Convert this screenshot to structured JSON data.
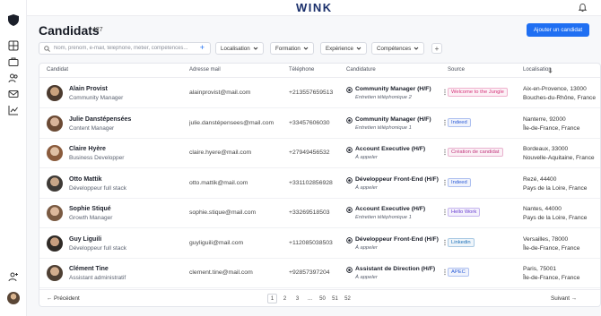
{
  "topbar": {
    "brand": "WINK"
  },
  "sidebar": {
    "items": [
      {
        "name": "layout-grid-icon"
      },
      {
        "name": "briefcase-icon"
      },
      {
        "name": "users-icon"
      },
      {
        "name": "mail-icon"
      },
      {
        "name": "chart-icon"
      }
    ]
  },
  "header": {
    "title": "Candidats",
    "count": "427",
    "add_button": "Ajouter un candidat"
  },
  "search": {
    "placeholder": "Nom, prénom, e-mail, téléphone, métier, compétences..."
  },
  "filters": [
    "Localisation",
    "Formation",
    "Expérience",
    "Compétences"
  ],
  "table": {
    "columns": [
      "Candidat",
      "Adresse mail",
      "Téléphone",
      "Candidature",
      "Source",
      "Localisation"
    ],
    "rows": [
      {
        "name": "Alain Provist",
        "role": "Community Manager",
        "email": "alainprovist@mail.com",
        "phone": "+213557659513",
        "job": "Community Manager (H/F)",
        "step": "Entretien téléphonique 2",
        "source": "Welcome to the Jungle",
        "loc1": "Aix-en-Provence, 13000",
        "loc2": "Bouches-du-Rhône, France"
      },
      {
        "name": "Julie Danstépensées",
        "role": "Content Manager",
        "email": "julie.danstépensees@mail.com",
        "phone": "+33457606030",
        "job": "Community Manager (H/F)",
        "step": "Entretien téléphonique 1",
        "source": "Indeed",
        "loc1": "Nanterre, 92000",
        "loc2": "Île-de-France, France"
      },
      {
        "name": "Claire Hyère",
        "role": "Business Developper",
        "email": "claire.hyere@mail.com",
        "phone": "+27949456532",
        "job": "Account Executive (H/F)",
        "step": "À appeler",
        "source": "Création de candidat",
        "loc1": "Bordeaux, 33000",
        "loc2": "Nouvelle-Aquitaine, France"
      },
      {
        "name": "Otto Mattik",
        "role": "Développeur full stack",
        "email": "otto.mattik@mail.com",
        "phone": "+331102856928",
        "job": "Développeur Front-End (H/F)",
        "step": "À appeler",
        "source": "Indeed",
        "loc1": "Rezé, 44400",
        "loc2": "Pays de la Loire, France"
      },
      {
        "name": "Sophie Stiqué",
        "role": "Growth Manager",
        "email": "sophie.stique@mail.com",
        "phone": "+33269518503",
        "job": "Account Executive (H/F)",
        "step": "Entretien téléphonique 1",
        "source": "Hello Work",
        "loc1": "Nantes, 44000",
        "loc2": "Pays de la Loire, France"
      },
      {
        "name": "Guy Liguili",
        "role": "Développeur full stack",
        "email": "guyliguili@mail.com",
        "phone": "+112085038503",
        "job": "Développeur Front-End (H/F)",
        "step": "À appeler",
        "source": "Linkedin",
        "loc1": "Versailles, 78000",
        "loc2": "Île-de-France, France"
      },
      {
        "name": "Clément Tine",
        "role": "Assistant administratif",
        "email": "clement.tine@mail.com",
        "phone": "+92857397204",
        "job": "Assistant de Direction (H/F)",
        "step": "À appeler",
        "source": "APEC",
        "loc1": "Paris, 75001",
        "loc2": "Île-de-France, France"
      }
    ]
  },
  "source_colors": {
    "Welcome to the Jungle": "#d6337a",
    "Indeed": "#2a5bd7",
    "Création de candidat": "#c2367d",
    "Hello Work": "#6a3fd1",
    "Linkedin": "#1a6fb8",
    "APEC": "#2a5bd7"
  },
  "pagination": {
    "prev": "Précédent",
    "next": "Suivant",
    "pages": [
      "1",
      "2",
      "3",
      "...",
      "50",
      "51",
      "52"
    ],
    "current": "1"
  }
}
